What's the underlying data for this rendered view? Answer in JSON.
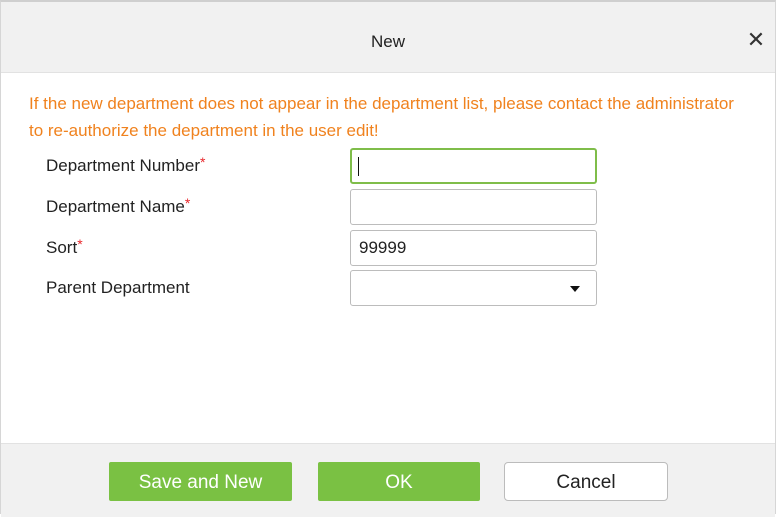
{
  "dialog": {
    "title": "New",
    "close_glyph": "✕",
    "notice": "If the new department does not appear in the department list, please contact the administrator to re-authorize the department in the user edit!"
  },
  "form": {
    "required_mark": "*",
    "fields": [
      {
        "label": "Department Number",
        "required": true,
        "value": ""
      },
      {
        "label": "Department Name",
        "required": true,
        "value": ""
      },
      {
        "label": "Sort",
        "required": true,
        "value": "99999"
      },
      {
        "label": "Parent Department",
        "required": false,
        "value": ""
      }
    ]
  },
  "footer": {
    "save_new_label": "Save and New",
    "ok_label": "OK",
    "cancel_label": "Cancel"
  },
  "colors": {
    "accent_green": "#7ac143",
    "notice_orange": "#f0821e",
    "required_red": "#e8262a"
  },
  "icons": {
    "close": "close-icon",
    "dropdown": "chevron-down-icon"
  }
}
